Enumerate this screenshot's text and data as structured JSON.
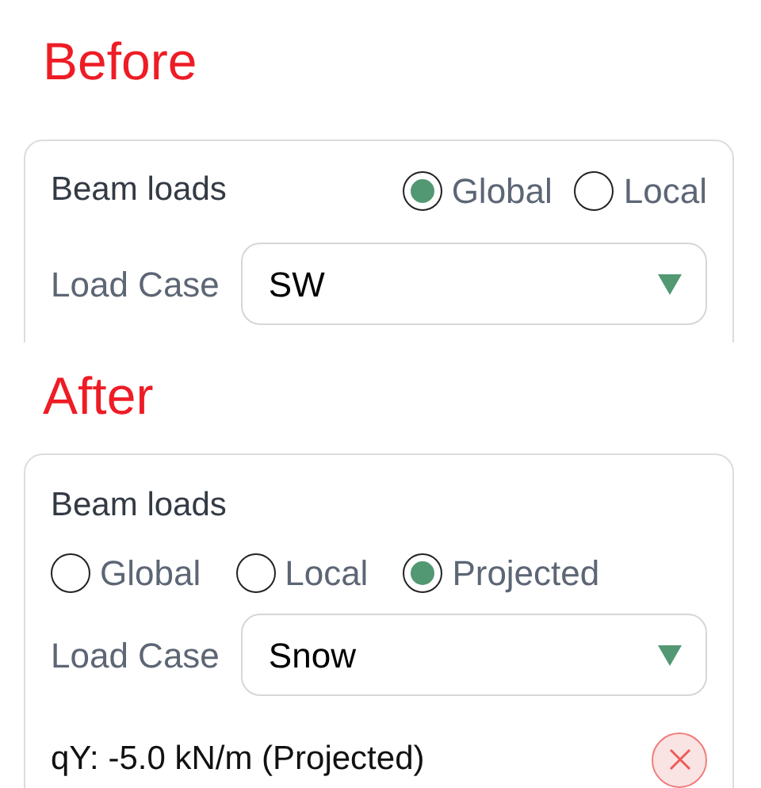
{
  "panels": [
    {
      "heading": "Before",
      "title": "Beam loads",
      "kind": "inline",
      "radios": [
        {
          "label": "Global",
          "selected": true
        },
        {
          "label": "Local",
          "selected": false
        }
      ],
      "load_case_label": "Load Case",
      "load_case": "SW"
    },
    {
      "heading": "After",
      "title": "Beam loads",
      "kind": "stacked",
      "radios": [
        {
          "label": "Global",
          "selected": false
        },
        {
          "label": "Local",
          "selected": false
        },
        {
          "label": "Projected",
          "selected": true
        }
      ],
      "load_case_label": "Load Case",
      "load_case": "Snow",
      "loads": [
        {
          "text": "qY: -5.0 kN/m (Projected)"
        }
      ]
    }
  ]
}
